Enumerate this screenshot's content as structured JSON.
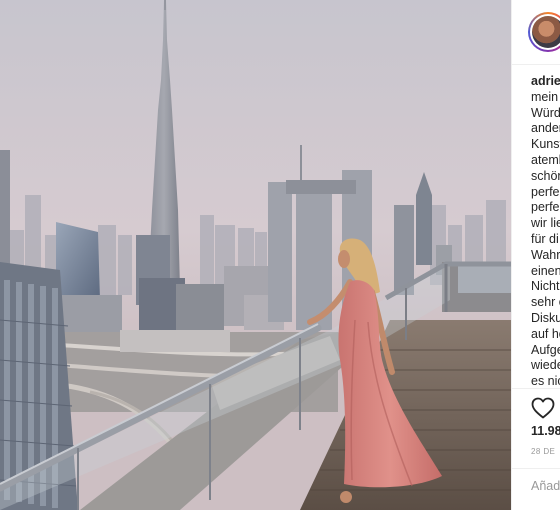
{
  "post": {
    "username": "adrie",
    "caption_lines": [
      "mein",
      "Würd",
      "ander",
      "Kunst",
      "atemb",
      "schön",
      "perfe",
      "perfe",
      "wir lie",
      "für di",
      "Wahr",
      "einen",
      "Nicht",
      "sehr c",
      "Disku",
      "auf ho",
      "Aufge",
      "wiede",
      "es nic"
    ],
    "likes": "11.98",
    "date": "28 DE",
    "comment_placeholder": "Añade"
  },
  "icons": {
    "like": "heart-icon"
  },
  "colors": {
    "dress": "#d9847f",
    "rail": "#9a9ea6",
    "sky": "#cfc8cf",
    "avatar_ring": "#dd2a7b"
  }
}
